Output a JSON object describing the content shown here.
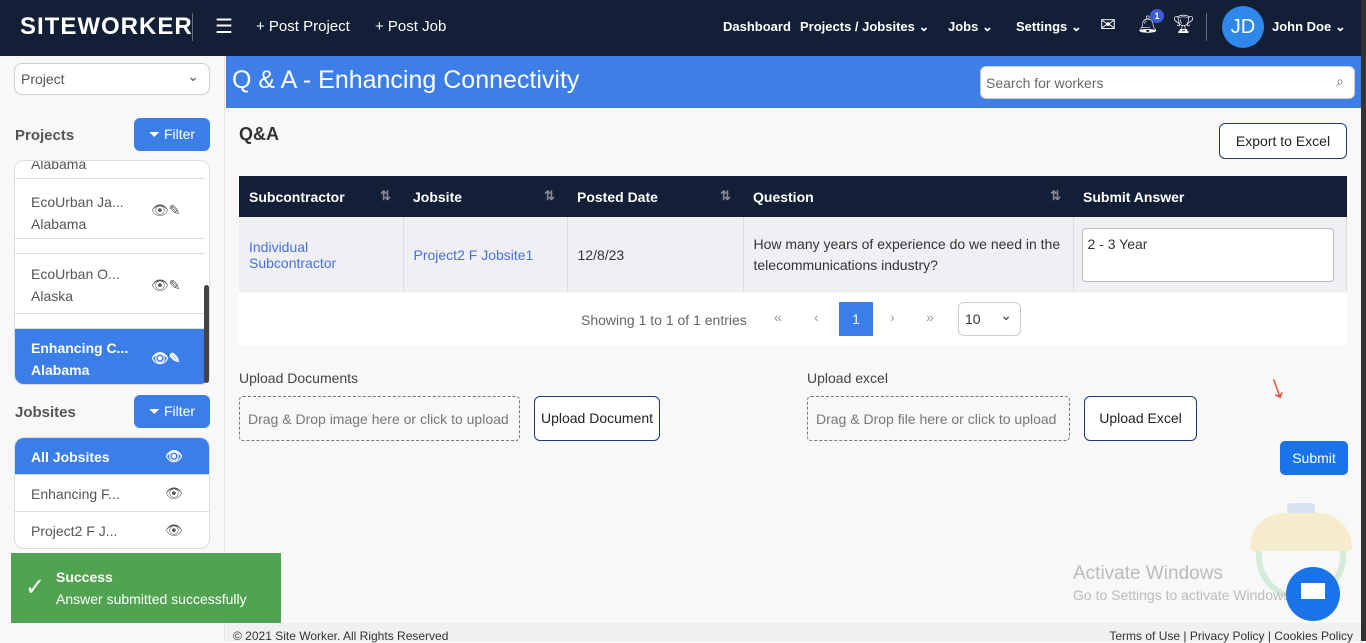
{
  "nav": {
    "logo": "SITEWORKER",
    "post_project": "+ Post Project",
    "post_job": "+ Post Job",
    "dashboard": "Dashboard",
    "projects": "Projects / Jobsites",
    "jobs": "Jobs",
    "settings": "Settings",
    "notif_count": "1",
    "avatar": "JD",
    "user": "John Doe"
  },
  "sidebar": {
    "select": "Project",
    "projects_heading": "Projects",
    "filter": "Filter",
    "jobsites_heading": "Jobsites",
    "projects": [
      {
        "name": "",
        "loc": "Alabama"
      },
      {
        "name": "EcoUrban Ja...",
        "loc": "Alabama"
      },
      {
        "name": "EcoUrban O...",
        "loc": "Alaska"
      },
      {
        "name": "Enhancing C...",
        "loc": "Alabama"
      }
    ],
    "jobsites": [
      "All Jobsites",
      "Enhancing F...",
      "Project2 F J..."
    ]
  },
  "toast": {
    "title": "Success",
    "message": "Answer submitted successfully"
  },
  "page": {
    "title": "Q & A - Enhancing Connectivity",
    "search_placeholder": "Search for workers",
    "heading": "Q&A",
    "export": "Export to Excel"
  },
  "table": {
    "headers": [
      "Subcontractor",
      "Jobsite",
      "Posted Date",
      "Question",
      "Submit Answer"
    ],
    "rows": [
      {
        "subcontractor": "Individual Subcontractor",
        "jobsite": "Project2 F Jobsite1",
        "date": "12/8/23",
        "question": "How many years of experience do we need in the telecommunications industry?",
        "answer": "2 - 3 Year"
      }
    ]
  },
  "pager": {
    "info": "Showing 1 to 1 of 1 entries",
    "page": "1",
    "size": "10"
  },
  "upload": {
    "docs_label": "Upload Documents",
    "docs_drop": "Drag & Drop image here or click to upload",
    "docs_btn": "Upload Document",
    "excel_label": "Upload excel",
    "excel_drop": "Drag & Drop file here or click to upload",
    "excel_btn": "Upload Excel",
    "submit": "Submit"
  },
  "watermark": {
    "line1": "Activate Windows",
    "line2": "Go to Settings to activate Windows."
  },
  "footer": {
    "copyright": "© 2021 Site Worker. All Rights Reserved",
    "links": "Terms of Use | Privacy Policy | Cookies Policy"
  }
}
